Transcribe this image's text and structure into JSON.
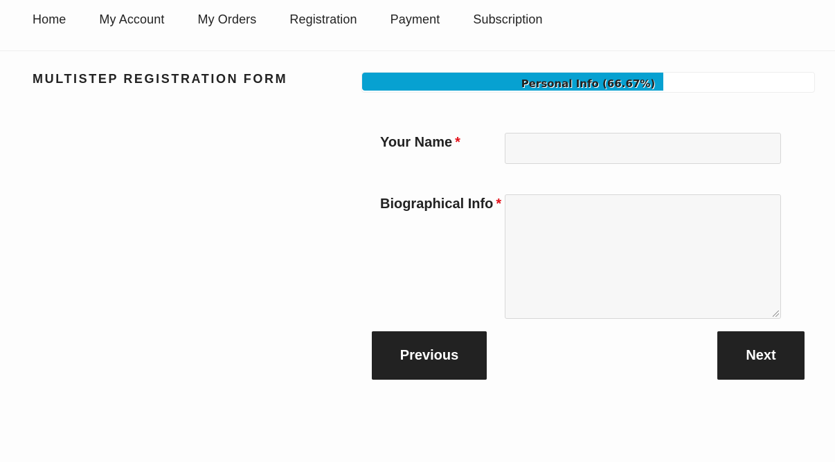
{
  "nav": {
    "items": [
      {
        "label": "Home"
      },
      {
        "label": "My Account"
      },
      {
        "label": "My Orders"
      },
      {
        "label": "Registration"
      },
      {
        "label": "Payment"
      },
      {
        "label": "Subscription"
      }
    ]
  },
  "page": {
    "title": "Multistep Registration Form"
  },
  "progress": {
    "step_label": "Personal Info",
    "percent_text": "(66.67%)",
    "percent": 66.67,
    "fill_color": "#07a1d1"
  },
  "form": {
    "fields": [
      {
        "label": "Your Name",
        "required_mark": "*",
        "value": "",
        "type": "text"
      },
      {
        "label": "Biographical Info",
        "required_mark": "*",
        "value": "",
        "type": "textarea"
      }
    ],
    "previous_label": "Previous",
    "next_label": "Next"
  },
  "colors": {
    "required": "#e3111a",
    "button_bg": "#222222"
  }
}
